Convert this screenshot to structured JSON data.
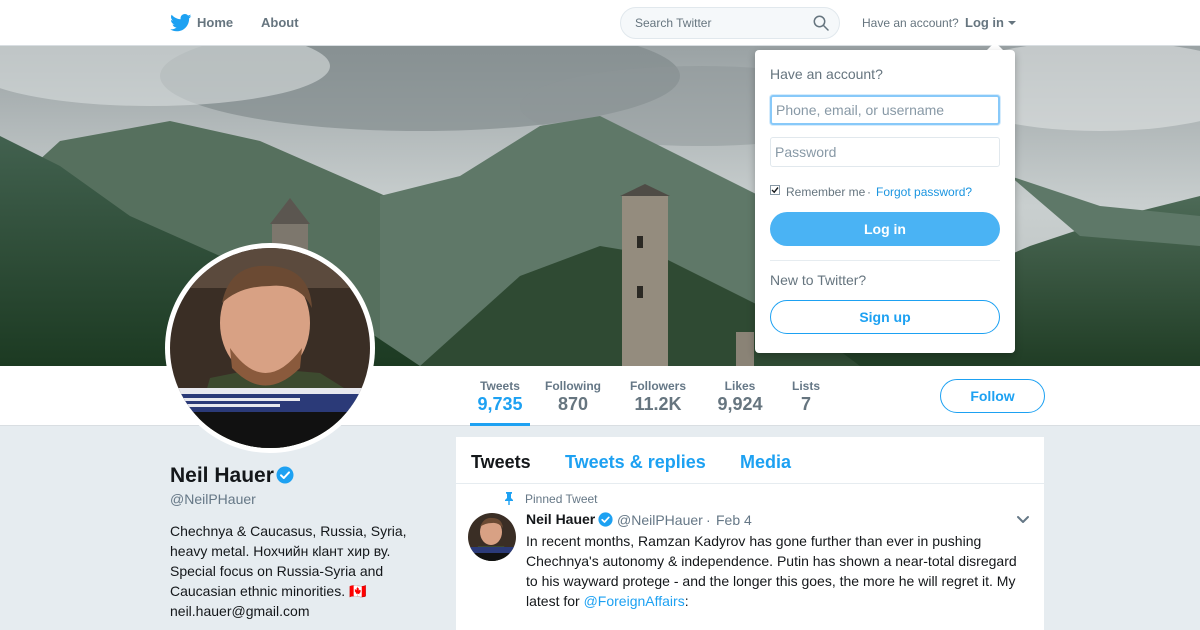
{
  "colors": {
    "accent": "#1da1f2",
    "text_primary": "#14171a",
    "text_secondary": "#657786",
    "background": "#e6ecf0"
  },
  "topnav": {
    "logo_icon": "twitter-bird-icon",
    "home_label": "Home",
    "about_label": "About",
    "search_placeholder": "Search Twitter",
    "search_icon": "search-icon",
    "have_account": "Have an account?",
    "login_label": "Log in"
  },
  "profile": {
    "name": "Neil Hauer",
    "handle": "@NeilPHauer",
    "verified_icon": "verified-badge-icon",
    "bio_lines": [
      "Chechnya & Caucasus, Russia, Syria,",
      "heavy metal. Нохчийн кlант хир ву.",
      "Special focus on Russia-Syria and",
      "Caucasian ethnic minorities. 🇨🇦",
      "neil.hauer@gmail.com"
    ]
  },
  "stats": [
    {
      "label": "Tweets",
      "value": "9,735"
    },
    {
      "label": "Following",
      "value": "870"
    },
    {
      "label": "Followers",
      "value": "11.2K"
    },
    {
      "label": "Likes",
      "value": "9,924"
    },
    {
      "label": "Lists",
      "value": "7"
    }
  ],
  "follow_label": "Follow",
  "timeline": {
    "tabs": [
      "Tweets",
      "Tweets & replies",
      "Media"
    ],
    "pinned_label": "Pinned Tweet",
    "tweet": {
      "name": "Neil Hauer",
      "handle": "@NeilPHauer",
      "separator": "·",
      "date": "Feb 4",
      "lines": [
        "In recent months, Ramzan Kadyrov has gone further than ever in pushing",
        "Chechnya's autonomy & independence. Putin has shown a near-total disregard",
        "to his wayward protege - and the longer this goes, the more he will regret it. My"
      ],
      "last_line_prefix": "latest for ",
      "mention": "@ForeignAffairs",
      "last_line_suffix": ":"
    }
  },
  "login_dropdown": {
    "title": "Have an account?",
    "username_placeholder": "Phone, email, or username",
    "password_placeholder": "Password",
    "remember_label": "Remember me",
    "separator": "·",
    "forgot_label": "Forgot password?",
    "login_button": "Log in",
    "new_label": "New to Twitter?",
    "signup_button": "Sign up"
  }
}
